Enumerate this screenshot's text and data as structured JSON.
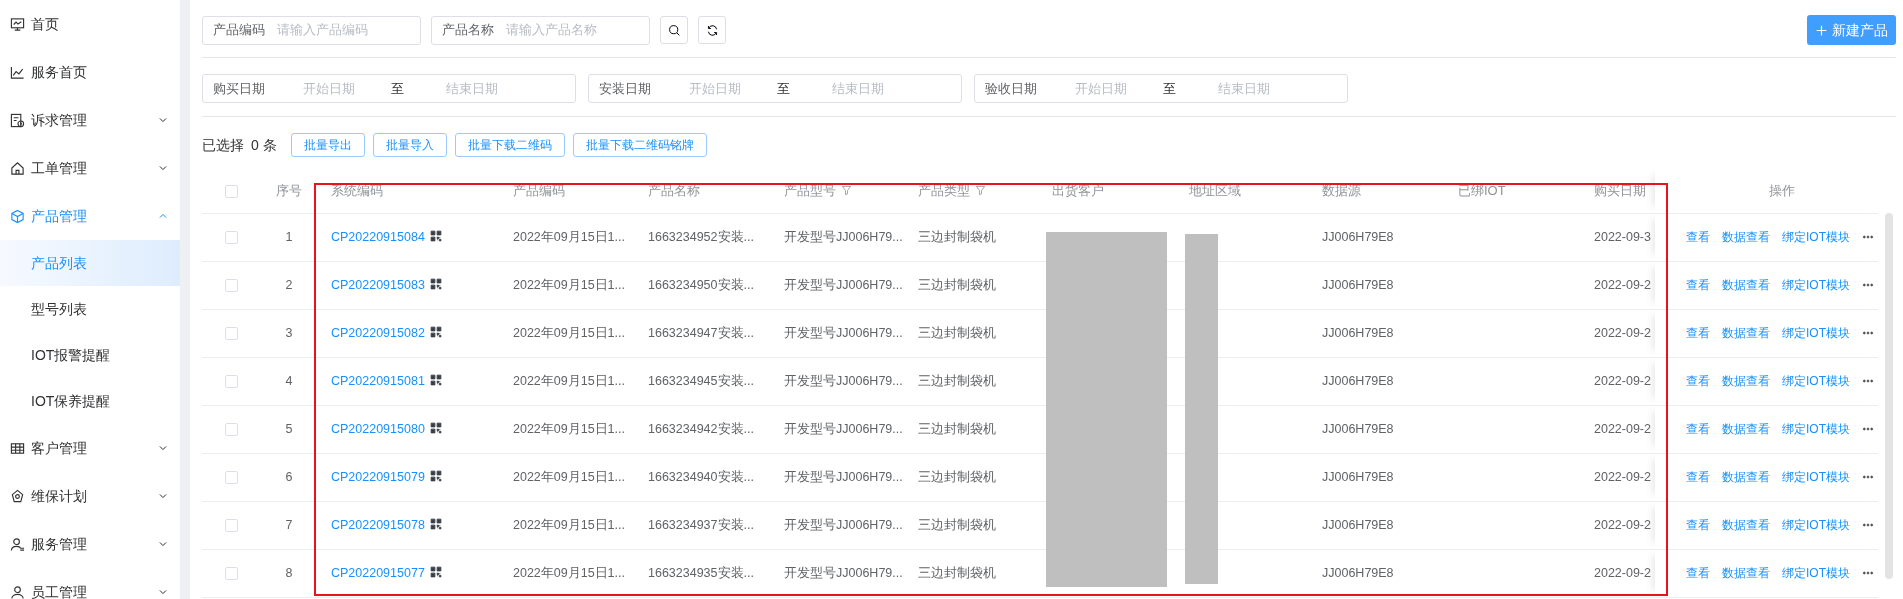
{
  "sidebar": {
    "items": [
      {
        "label": "首页",
        "selected": false
      },
      {
        "label": "服务首页",
        "selected": false
      },
      {
        "label": "诉求管理",
        "expanded": false,
        "selected": false
      },
      {
        "label": "工单管理",
        "expanded": false,
        "selected": false
      },
      {
        "label": "产品管理",
        "expanded": true,
        "selected": true,
        "children": [
          {
            "label": "产品列表",
            "selected": true
          },
          {
            "label": "型号列表",
            "selected": false
          },
          {
            "label": "IOT报警提醒",
            "selected": false
          },
          {
            "label": "IOT保养提醒",
            "selected": false
          }
        ]
      },
      {
        "label": "客户管理",
        "expanded": false,
        "selected": false
      },
      {
        "label": "维保计划",
        "expanded": false,
        "selected": false
      },
      {
        "label": "服务管理",
        "expanded": false,
        "selected": false
      },
      {
        "label": "员工管理",
        "expanded": false,
        "selected": false
      }
    ]
  },
  "search_fields": [
    {
      "label": "产品编码",
      "placeholder": "请输入产品编码"
    },
    {
      "label": "产品名称",
      "placeholder": "请输入产品名称"
    }
  ],
  "new_button": {
    "label": "新建产品"
  },
  "date_ranges": [
    {
      "label": "购买日期",
      "start_placeholder": "开始日期",
      "separator": "至",
      "end_placeholder": "结束日期"
    },
    {
      "label": "安装日期",
      "start_placeholder": "开始日期",
      "separator": "至",
      "end_placeholder": "结束日期"
    },
    {
      "label": "验收日期",
      "start_placeholder": "开始日期",
      "separator": "至",
      "end_placeholder": "结束日期"
    }
  ],
  "selection": {
    "prefix": "已选择",
    "count": "0",
    "suffix": "条"
  },
  "batch_buttons": [
    "批量导出",
    "批量导入",
    "批量下载二维码",
    "批量下载二维码铭牌"
  ],
  "table": {
    "all_checked": false,
    "columns": [
      {
        "label": "序号",
        "filter": false
      },
      {
        "label": "系统编码",
        "filter": false
      },
      {
        "label": "产品编码",
        "filter": false
      },
      {
        "label": "产品名称",
        "filter": false
      },
      {
        "label": "产品型号",
        "filter": true
      },
      {
        "label": "产品类型",
        "filter": true
      },
      {
        "label": "出货客户",
        "filter": false
      },
      {
        "label": "地址区域",
        "filter": false
      },
      {
        "label": "数据源",
        "filter": false
      },
      {
        "label": "已绑IOT",
        "filter": false
      },
      {
        "label": "购买日期",
        "filter": false
      },
      {
        "label": "操作",
        "filter": false
      }
    ],
    "rows": [
      {
        "checked": false,
        "index": "1",
        "system_code": "CP20220915084",
        "product_code": "2022年09月15日1...",
        "product_name": "1663234952安装...",
        "model": "开发型号JJ006H79...",
        "type": "三边封制袋机",
        "data_source": "JJ006H79E8",
        "purchase_date": "2022-09-3",
        "actions": [
          "查看",
          "数据查看",
          "绑定IOT模块"
        ]
      },
      {
        "checked": false,
        "index": "2",
        "system_code": "CP20220915083",
        "product_code": "2022年09月15日1...",
        "product_name": "1663234950安装...",
        "model": "开发型号JJ006H79...",
        "type": "三边封制袋机",
        "data_source": "JJ006H79E8",
        "purchase_date": "2022-09-2",
        "actions": [
          "查看",
          "数据查看",
          "绑定IOT模块"
        ]
      },
      {
        "checked": false,
        "index": "3",
        "system_code": "CP20220915082",
        "product_code": "2022年09月15日1...",
        "product_name": "1663234947安装...",
        "model": "开发型号JJ006H79...",
        "type": "三边封制袋机",
        "data_source": "JJ006H79E8",
        "purchase_date": "2022-09-2",
        "actions": [
          "查看",
          "数据查看",
          "绑定IOT模块"
        ]
      },
      {
        "checked": false,
        "index": "4",
        "system_code": "CP20220915081",
        "product_code": "2022年09月15日1...",
        "product_name": "1663234945安装...",
        "model": "开发型号JJ006H79...",
        "type": "三边封制袋机",
        "data_source": "JJ006H79E8",
        "purchase_date": "2022-09-2",
        "actions": [
          "查看",
          "数据查看",
          "绑定IOT模块"
        ]
      },
      {
        "checked": false,
        "index": "5",
        "system_code": "CP20220915080",
        "product_code": "2022年09月15日1...",
        "product_name": "1663234942安装...",
        "model": "开发型号JJ006H79...",
        "type": "三边封制袋机",
        "data_source": "JJ006H79E8",
        "purchase_date": "2022-09-2",
        "actions": [
          "查看",
          "数据查看",
          "绑定IOT模块"
        ]
      },
      {
        "checked": false,
        "index": "6",
        "system_code": "CP20220915079",
        "product_code": "2022年09月15日1...",
        "product_name": "1663234940安装...",
        "model": "开发型号JJ006H79...",
        "type": "三边封制袋机",
        "data_source": "JJ006H79E8",
        "purchase_date": "2022-09-2",
        "actions": [
          "查看",
          "数据查看",
          "绑定IOT模块"
        ]
      },
      {
        "checked": false,
        "index": "7",
        "system_code": "CP20220915078",
        "product_code": "2022年09月15日1...",
        "product_name": "1663234937安装...",
        "model": "开发型号JJ006H79...",
        "type": "三边封制袋机",
        "data_source": "JJ006H79E8",
        "purchase_date": "2022-09-2",
        "actions": [
          "查看",
          "数据查看",
          "绑定IOT模块"
        ]
      },
      {
        "checked": false,
        "index": "8",
        "system_code": "CP20220915077",
        "product_code": "2022年09月15日1...",
        "product_name": "1663234935安装...",
        "model": "开发型号JJ006H79...",
        "type": "三边封制袋机",
        "data_source": "JJ006H79E8",
        "purchase_date": "2022-09-2",
        "actions": [
          "查看",
          "数据查看",
          "绑定IOT模块"
        ]
      }
    ]
  }
}
